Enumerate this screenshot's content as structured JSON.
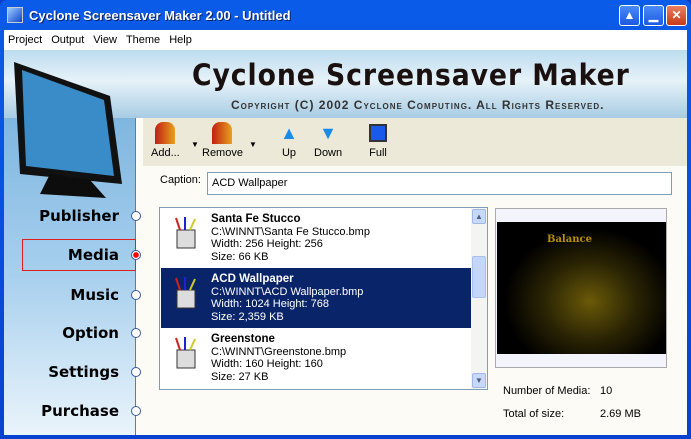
{
  "window": {
    "title": "Cyclone Screensaver Maker 2.00 - Untitled"
  },
  "menu": [
    "Project",
    "Output",
    "View",
    "Theme",
    "Help"
  ],
  "banner": {
    "title": "Cyclone Screensaver Maker",
    "copyright": "Copyright (C) 2002 Cyclone Computing. All Rights Reserved."
  },
  "nav": [
    {
      "label": "Publisher",
      "selected": false
    },
    {
      "label": "Media",
      "selected": true
    },
    {
      "label": "Music",
      "selected": false
    },
    {
      "label": "Option",
      "selected": false
    },
    {
      "label": "Settings",
      "selected": false
    },
    {
      "label": "Purchase",
      "selected": false
    }
  ],
  "toolbar": {
    "add": "Add...",
    "remove": "Remove",
    "up": "Up",
    "down": "Down",
    "full": "Full"
  },
  "caption": {
    "label": "Caption:",
    "value": "ACD Wallpaper"
  },
  "media": [
    {
      "name": "Santa Fe Stucco",
      "path": "C:\\WINNT\\Santa Fe Stucco.bmp",
      "dims": "Width: 256 Height: 256",
      "size": "Size: 66 KB"
    },
    {
      "name": "ACD Wallpaper",
      "path": "C:\\WINNT\\ACD Wallpaper.bmp",
      "dims": "Width: 1024 Height: 768",
      "size": "Size: 2,359 KB"
    },
    {
      "name": "Greenstone",
      "path": "C:\\WINNT\\Greenstone.bmp",
      "dims": "Width: 160 Height: 160",
      "size": "Size: 27 KB"
    }
  ],
  "preview": {
    "text": "Balance"
  },
  "stats": {
    "count_label": "Number of Media:",
    "count": "10",
    "total_label": "Total of size:",
    "total": "2.69 MB"
  },
  "colors": {
    "selection": "#0a246a",
    "titlebar": "#0a5ce8"
  }
}
